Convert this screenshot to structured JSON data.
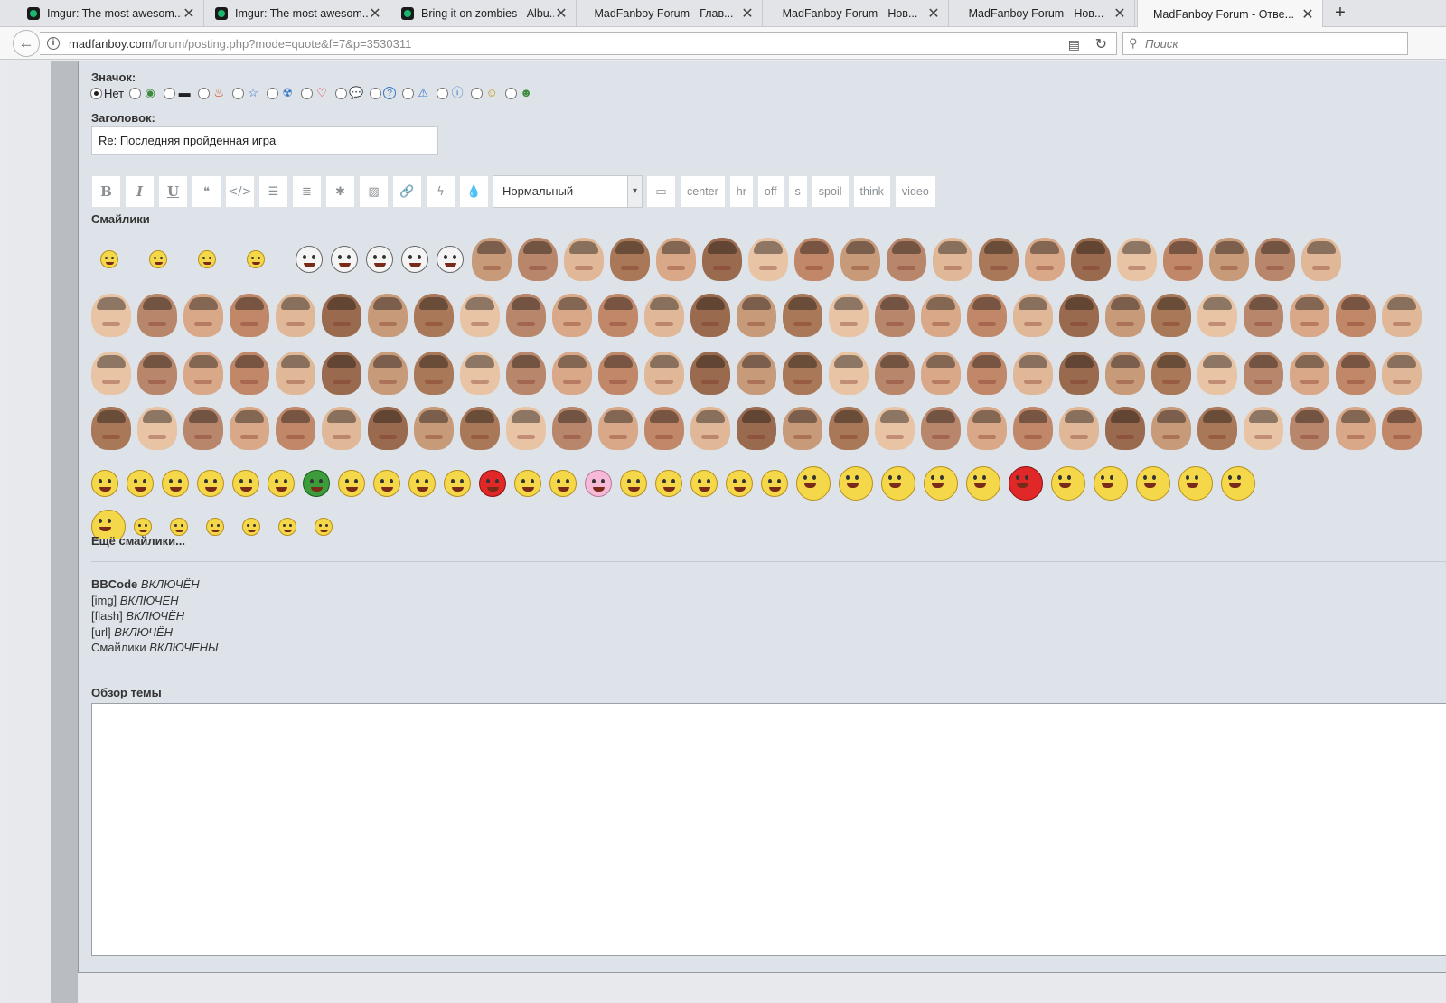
{
  "browser": {
    "tabs": [
      {
        "title": "Imgur: The most awesom...",
        "icon": "imgur-favicon",
        "active": false
      },
      {
        "title": "Imgur: The most awesom...",
        "icon": "imgur-favicon",
        "active": false
      },
      {
        "title": "Bring it on zombies - Albu...",
        "icon": "imgur-favicon",
        "active": false
      },
      {
        "title": "MadFanboy Forum - Глав...",
        "icon": "",
        "active": false
      },
      {
        "title": "MadFanboy Forum - Нов...",
        "icon": "",
        "active": false
      },
      {
        "title": "MadFanboy Forum - Нов...",
        "icon": "",
        "active": false
      },
      {
        "title": "MadFanboy Forum - Отве...",
        "icon": "",
        "active": true
      }
    ],
    "close_glyph": "✕",
    "new_tab_glyph": "+",
    "url_domain": "madfanboy.com",
    "url_path": "/forum/posting.php?mode=quote&f=7&p=3530311",
    "search_placeholder": "Поиск"
  },
  "form": {
    "icon_label": "Значок:",
    "icon_none_label": "Нет",
    "post_icons": [
      "xbox-icon",
      "monitor-icon",
      "fire-icon",
      "star-icon",
      "radiation-icon",
      "heart-icon",
      "speech-bubble-icon",
      "question-icon",
      "warning-icon",
      "info-icon",
      "wink-icon",
      "grin-icon"
    ],
    "subject_label": "Заголовок:",
    "subject_value": "Re: Последняя пройденная игра",
    "toolbar": {
      "format_buttons": [
        {
          "name": "bold-button",
          "glyph": "B",
          "style": "b"
        },
        {
          "name": "italic-button",
          "glyph": "I",
          "style": "i"
        },
        {
          "name": "underline-button",
          "glyph": "U",
          "style": "u"
        },
        {
          "name": "quote-button",
          "glyph": "❝",
          "style": ""
        },
        {
          "name": "code-button",
          "glyph": "</>",
          "style": ""
        },
        {
          "name": "list-button",
          "glyph": "☰",
          "style": ""
        },
        {
          "name": "ordered-list-button",
          "glyph": "≣",
          "style": ""
        },
        {
          "name": "list-item-button",
          "glyph": "✱",
          "style": ""
        },
        {
          "name": "image-button",
          "glyph": "▨",
          "style": ""
        },
        {
          "name": "link-button",
          "glyph": "🔗",
          "style": ""
        },
        {
          "name": "flash-button",
          "glyph": "ϟ",
          "style": ""
        },
        {
          "name": "color-button",
          "glyph": "💧",
          "style": ""
        }
      ],
      "font_size_selected": "Нормальный",
      "screen_glyph": "▭",
      "custom_tags": [
        "center",
        "hr",
        "off",
        "s",
        "spoil",
        "think",
        "video"
      ]
    },
    "smileys_label": "Смайлики",
    "more_smileys_label": "Ещё смайлики...",
    "status_lines": [
      {
        "tag": "BBCode",
        "bold": true,
        "state": "ВКЛЮЧЁН"
      },
      {
        "tag": "[img]",
        "bold": false,
        "state": "ВКЛЮЧЁН"
      },
      {
        "tag": "[flash]",
        "bold": false,
        "state": "ВКЛЮЧЁН"
      },
      {
        "tag": "[url]",
        "bold": false,
        "state": "ВКЛЮЧЁН"
      },
      {
        "tag": "Смайлики",
        "bold": false,
        "state": "ВКЛЮЧЕНЫ"
      }
    ],
    "overview_label": "Обзор темы"
  },
  "colors": {
    "panel_bg": "#dde3e8",
    "imgur_green": "#1bb76e"
  }
}
